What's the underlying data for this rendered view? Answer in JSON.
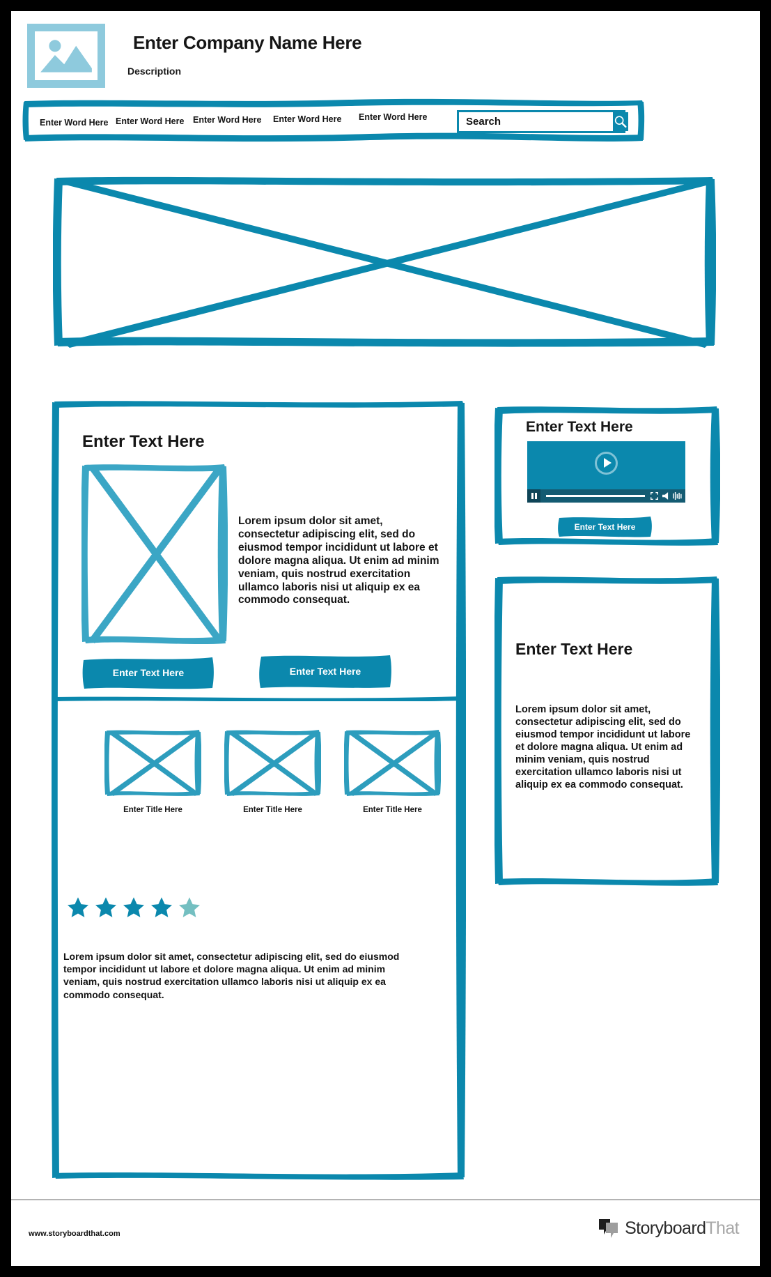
{
  "theme": {
    "accent": "#0b88ad",
    "accent_light": "#8ecadd",
    "star_full": "#0b88ad",
    "star_faded": "#74bfc1",
    "player_bg": "#0b88ad",
    "player_bar": "#145b72",
    "text": "#141414"
  },
  "header": {
    "logo_icon": "image-placeholder-icon",
    "company_name": "Enter Company Name Here",
    "description": "Description"
  },
  "nav": {
    "items": [
      {
        "label": "Enter Word Here"
      },
      {
        "label": "Enter Word Here"
      },
      {
        "label": "Enter Word Here"
      },
      {
        "label": "Enter Word Here"
      },
      {
        "label": "Enter Word Here"
      }
    ],
    "search": {
      "value": "Search",
      "placeholder": "Search",
      "icon": "search-icon"
    }
  },
  "hero": {
    "placeholder_icon": "image-placeholder-x-icon"
  },
  "main_card": {
    "title": "Enter Text Here",
    "image_placeholder": "image-placeholder-x-icon",
    "paragraph": "Lorem ipsum dolor sit amet, consectetur adipiscing elit, sed do eiusmod tempor incididunt ut labore et dolore magna aliqua. Ut enim ad minim veniam, quis nostrud exercitation ullamco laboris nisi ut aliquip ex ea commodo consequat.",
    "buttons": [
      {
        "label": "Enter Text Here"
      },
      {
        "label": "Enter Text Here"
      }
    ],
    "thumbnails": [
      {
        "caption": "Enter Title Here",
        "icon": "image-placeholder-x-icon"
      },
      {
        "caption": "Enter Title Here",
        "icon": "image-placeholder-x-icon"
      },
      {
        "caption": "Enter Title Here",
        "icon": "image-placeholder-x-icon"
      }
    ],
    "rating": {
      "value": 4,
      "max": 5,
      "stars": [
        "full",
        "full",
        "full",
        "full",
        "faded"
      ]
    },
    "review_text": "Lorem ipsum dolor sit amet, consectetur adipiscing elit, sed do eiusmod tempor incididunt ut labore et dolore magna aliqua. Ut enim ad minim veniam, quis nostrud exercitation ullamco laboris nisi ut aliquip ex ea commodo consequat."
  },
  "video_card": {
    "title": "Enter Text Here",
    "player": {
      "play_icon": "play-icon",
      "pause_icon": "pause-icon",
      "fullscreen_icon": "fullscreen-icon",
      "volume_icon": "volume-icon",
      "equalizer_icon": "equalizer-icon"
    },
    "button_label": "Enter Text Here"
  },
  "text_card": {
    "title": "Enter Text Here",
    "paragraph": "Lorem ipsum dolor sit amet, consectetur adipiscing elit, sed do eiusmod tempor incididunt ut labore et dolore magna aliqua. Ut enim ad minim veniam, quis nostrud exercitation ullamco laboris nisi ut aliquip ex ea commodo consequat."
  },
  "footer": {
    "url": "www.storyboardthat.com",
    "brand_first": "Storyboard",
    "brand_second": "That",
    "brand_icon": "speech-bubbles-icon"
  }
}
